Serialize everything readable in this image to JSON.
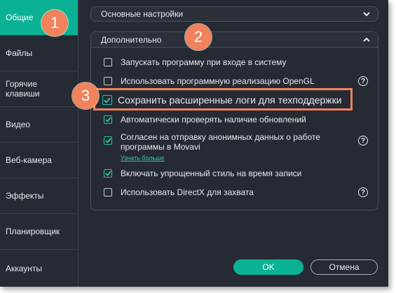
{
  "sidebar": {
    "items": [
      {
        "label": "Общие",
        "active": true
      },
      {
        "label": "Файлы"
      },
      {
        "label": "Горячие клавиши"
      },
      {
        "label": "Видео"
      },
      {
        "label": "Веб-камера"
      },
      {
        "label": "Эффекты"
      },
      {
        "label": "Планировщик"
      },
      {
        "label": "Аккаунты"
      }
    ]
  },
  "sections": {
    "basic": {
      "title": "Основные настройки",
      "icon": "chevron-down-icon"
    },
    "advanced": {
      "title": "Дополнительно",
      "icon": "chevron-up-icon"
    }
  },
  "options": [
    {
      "label": "Запускать программу при входе в систему",
      "checked": false
    },
    {
      "label": "Использовать программную реализацию OpenGL",
      "checked": false,
      "help": "?"
    },
    {
      "label": "Сохранить расширенные логи для техподдержки",
      "checked": true
    },
    {
      "label": "Автоматически проверять наличие обновлений",
      "checked": true
    },
    {
      "label": "Согласен на отправку анонимных данных о работе программы в Movavi",
      "checked": true,
      "help": "?",
      "link": "Узнать больше"
    },
    {
      "label": "Включать упрощенный стиль на время записи",
      "checked": true
    },
    {
      "label": "Использовать DirectX для захвата",
      "checked": false,
      "help": "?"
    }
  ],
  "buttons": {
    "ok": "OK",
    "cancel": "Отмена"
  },
  "markers": [
    "1",
    "2",
    "3"
  ],
  "colors": {
    "accent": "#0bb195",
    "marker": "#f0825c",
    "background": "#262a33"
  }
}
